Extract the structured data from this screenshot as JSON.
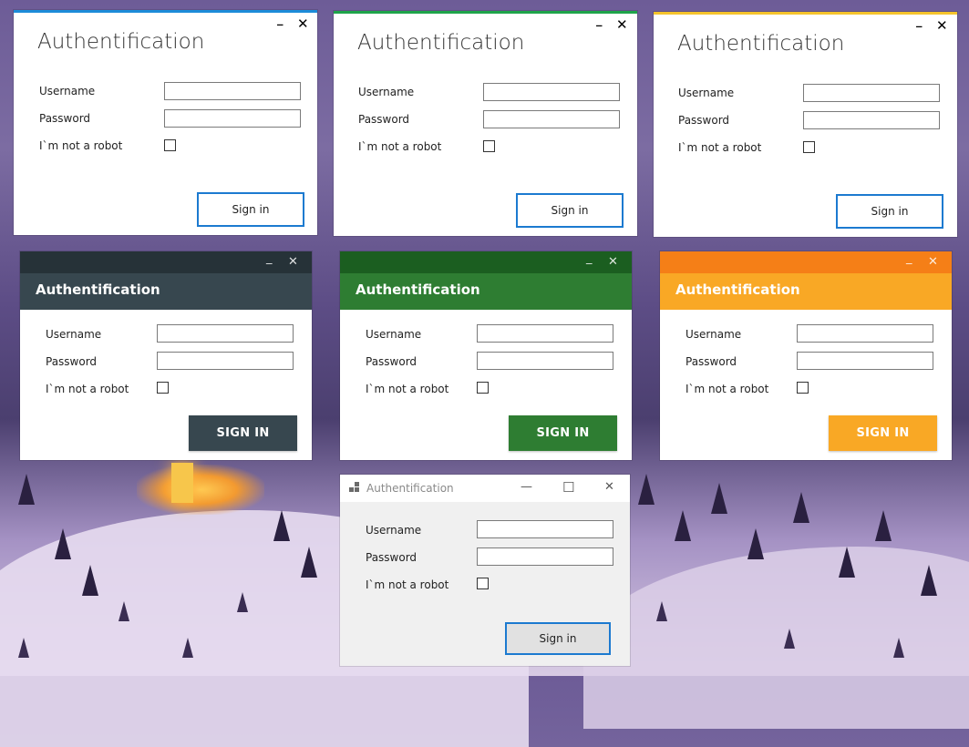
{
  "windows": [
    {
      "style": "metro",
      "accent": "#1c8cd9",
      "title": "Authentification",
      "minimize_glyph": "_",
      "close_glyph": "✕",
      "fields": {
        "username_label": "Username",
        "password_label": "Password",
        "robot_label": "I`m not a robot",
        "username_value": "",
        "password_value": ""
      },
      "robot_checked": false,
      "sign_in_label": "Sign in"
    },
    {
      "style": "metro",
      "accent": "#1ea44a",
      "title": "Authentification",
      "minimize_glyph": "_",
      "close_glyph": "✕",
      "fields": {
        "username_label": "Username",
        "password_label": "Password",
        "robot_label": "I`m not a robot",
        "username_value": "",
        "password_value": ""
      },
      "robot_checked": false,
      "sign_in_label": "Sign in"
    },
    {
      "style": "metro",
      "accent": "#f5c32c",
      "title": "Authentification",
      "minimize_glyph": "_",
      "close_glyph": "✕",
      "fields": {
        "username_label": "Username",
        "password_label": "Password",
        "robot_label": "I`m not a robot",
        "username_value": "",
        "password_value": ""
      },
      "robot_checked": false,
      "sign_in_label": "Sign in"
    },
    {
      "style": "material",
      "bar_color": "#263238",
      "header_color": "#37474f",
      "button_color": "#37474f",
      "title": "Authentification",
      "minimize_glyph": "_",
      "close_glyph": "✕",
      "fields": {
        "username_label": "Username",
        "password_label": "Password",
        "robot_label": "I`m not a robot",
        "username_value": "",
        "password_value": ""
      },
      "robot_checked": false,
      "sign_in_label": "SIGN IN"
    },
    {
      "style": "material",
      "bar_color": "#1b5e20",
      "header_color": "#2e7d32",
      "button_color": "#2e7d32",
      "title": "Authentification",
      "minimize_glyph": "_",
      "close_glyph": "✕",
      "fields": {
        "username_label": "Username",
        "password_label": "Password",
        "robot_label": "I`m not a robot",
        "username_value": "",
        "password_value": ""
      },
      "robot_checked": false,
      "sign_in_label": "SIGN IN"
    },
    {
      "style": "material",
      "bar_color": "#f57f17",
      "header_color": "#f9a825",
      "button_color": "#f9a825",
      "title": "Authentification",
      "minimize_glyph": "_",
      "close_glyph": "✕",
      "fields": {
        "username_label": "Username",
        "password_label": "Password",
        "robot_label": "I`m not a robot",
        "username_value": "",
        "password_value": ""
      },
      "robot_checked": false,
      "sign_in_label": "SIGN IN"
    },
    {
      "style": "classic",
      "title": "Authentification",
      "minimize_glyph": "—",
      "maximize_glyph": "☐",
      "close_glyph": "✕",
      "fields": {
        "username_label": "Username",
        "password_label": "Password",
        "robot_label": "I`m not a robot",
        "username_value": "",
        "password_value": ""
      },
      "robot_checked": false,
      "sign_in_label": "Sign in"
    }
  ]
}
